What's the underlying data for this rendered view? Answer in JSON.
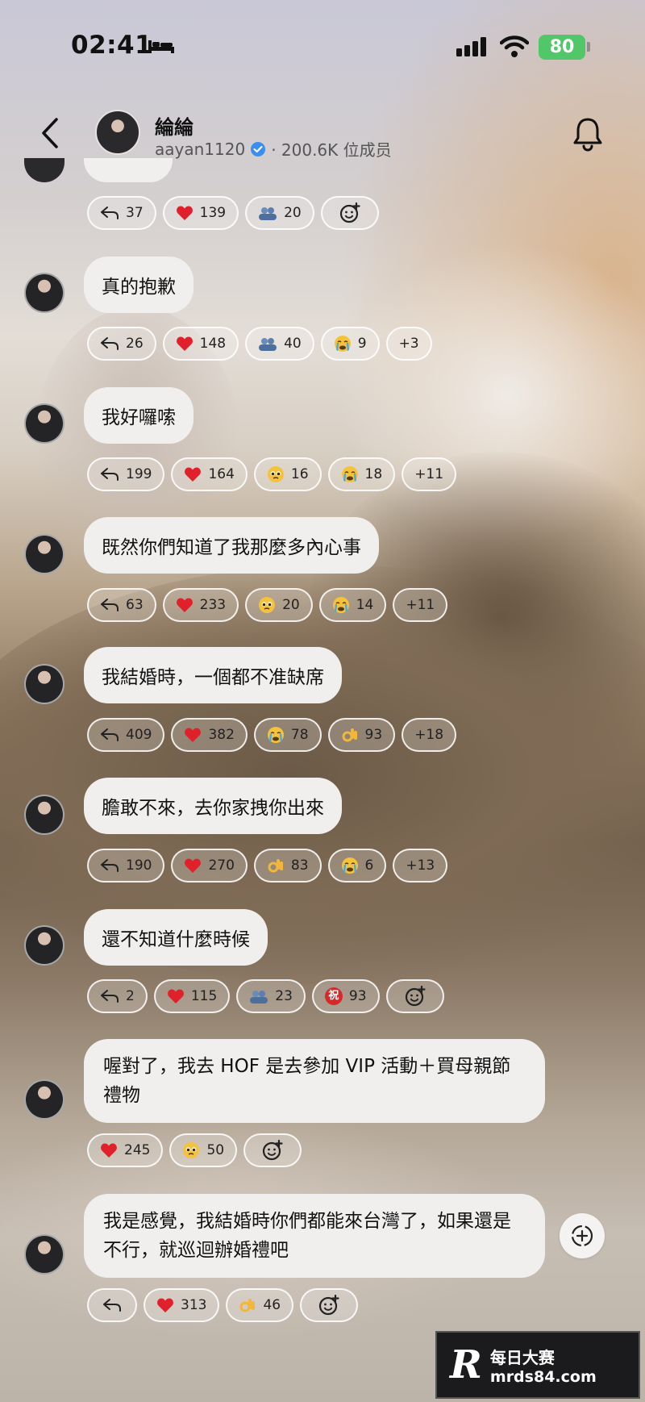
{
  "status_bar": {
    "time": "02:41",
    "battery": "80"
  },
  "header": {
    "name": "綸綸",
    "handle": "aayan1120",
    "members": "· 200.6K 位成员"
  },
  "messages": [
    {
      "text": "",
      "reactions": [
        {
          "type": "reply",
          "count": "37"
        },
        {
          "type": "heart",
          "count": "139"
        },
        {
          "type": "group",
          "count": "20"
        },
        {
          "type": "add",
          "count": ""
        }
      ]
    },
    {
      "text": "真的抱歉",
      "reactions": [
        {
          "type": "reply",
          "count": "26"
        },
        {
          "type": "heart",
          "count": "148"
        },
        {
          "type": "group",
          "count": "40"
        },
        {
          "type": "crying",
          "count": "9"
        },
        {
          "type": "more",
          "count": "+3"
        }
      ]
    },
    {
      "text": "我好囉嗦",
      "reactions": [
        {
          "type": "reply",
          "count": "199"
        },
        {
          "type": "heart",
          "count": "164"
        },
        {
          "type": "pleading",
          "count": "16"
        },
        {
          "type": "crying",
          "count": "18"
        },
        {
          "type": "more",
          "count": "+11"
        }
      ]
    },
    {
      "text": "既然你們知道了我那麼多內心事",
      "reactions": [
        {
          "type": "reply",
          "count": "63"
        },
        {
          "type": "heart",
          "count": "233"
        },
        {
          "type": "pleading",
          "count": "20"
        },
        {
          "type": "crying",
          "count": "14"
        },
        {
          "type": "more",
          "count": "+11"
        }
      ]
    },
    {
      "text": "我結婚時，一個都不准缺席",
      "reactions": [
        {
          "type": "reply",
          "count": "409"
        },
        {
          "type": "heart",
          "count": "382"
        },
        {
          "type": "crying",
          "count": "78"
        },
        {
          "type": "ok",
          "count": "93"
        },
        {
          "type": "more",
          "count": "+18"
        }
      ]
    },
    {
      "text": "膽敢不來，去你家拽你出來",
      "reactions": [
        {
          "type": "reply",
          "count": "190"
        },
        {
          "type": "heart",
          "count": "270"
        },
        {
          "type": "ok",
          "count": "83"
        },
        {
          "type": "crying",
          "count": "6"
        },
        {
          "type": "more",
          "count": "+13"
        }
      ]
    },
    {
      "text": "還不知道什麼時候",
      "reactions": [
        {
          "type": "reply",
          "count": "2"
        },
        {
          "type": "heart",
          "count": "115"
        },
        {
          "type": "group",
          "count": "23"
        },
        {
          "type": "zhu",
          "count": "93"
        },
        {
          "type": "add",
          "count": ""
        }
      ]
    },
    {
      "text": "喔對了，我去 HOF 是去參加 VIP 活動＋買母親節禮物",
      "reactions": [
        {
          "type": "heart",
          "count": "245"
        },
        {
          "type": "pleading",
          "count": "50"
        },
        {
          "type": "add",
          "count": ""
        }
      ]
    },
    {
      "text": "我是感覺，我結婚時你們都能來台灣了，如果還是不行，就巡迴辦婚禮吧",
      "reactions": [
        {
          "type": "reply",
          "count": ""
        },
        {
          "type": "heart",
          "count": "313"
        },
        {
          "type": "ok",
          "count": "46"
        },
        {
          "type": "add",
          "count": ""
        }
      ]
    }
  ],
  "watermark": {
    "logo": "R",
    "title": "每日大赛",
    "url": "mrds84.com"
  },
  "colors": {
    "bubble": "#f1efee",
    "battery": "#52c76a",
    "verified": "#3a8ef0"
  }
}
